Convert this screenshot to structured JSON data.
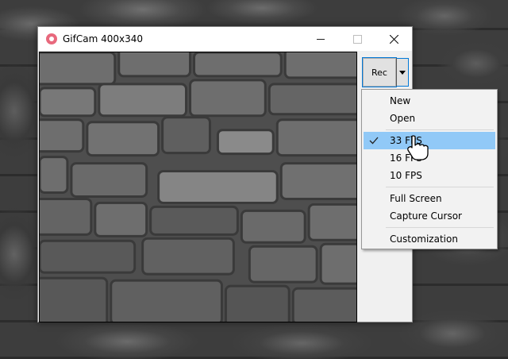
{
  "window": {
    "title": "GifCam 400x340",
    "controls": [
      "minimize",
      "maximize",
      "close"
    ]
  },
  "toolbar": {
    "rec_label": "Rec"
  },
  "menu": {
    "items": [
      {
        "label": "New",
        "checked": false
      },
      {
        "label": "Open",
        "checked": false
      },
      {
        "label": "33 FPS",
        "checked": true,
        "highlighted": true
      },
      {
        "label": "16 FPS",
        "checked": false
      },
      {
        "label": "10 FPS",
        "checked": false
      },
      {
        "label": "Full Screen",
        "checked": false
      },
      {
        "label": "Capture Cursor",
        "checked": false
      },
      {
        "label": "Customization",
        "checked": false
      }
    ]
  },
  "colors": {
    "app_icon": "#e8697d",
    "menu_highlight": "#91c9f7",
    "focus_outline": "#0078d7"
  },
  "icons": {
    "app": "gifcam-icon",
    "dropdown": "triangle-down-icon",
    "check": "checkmark-icon",
    "pointer": "hand-pointer-icon"
  }
}
